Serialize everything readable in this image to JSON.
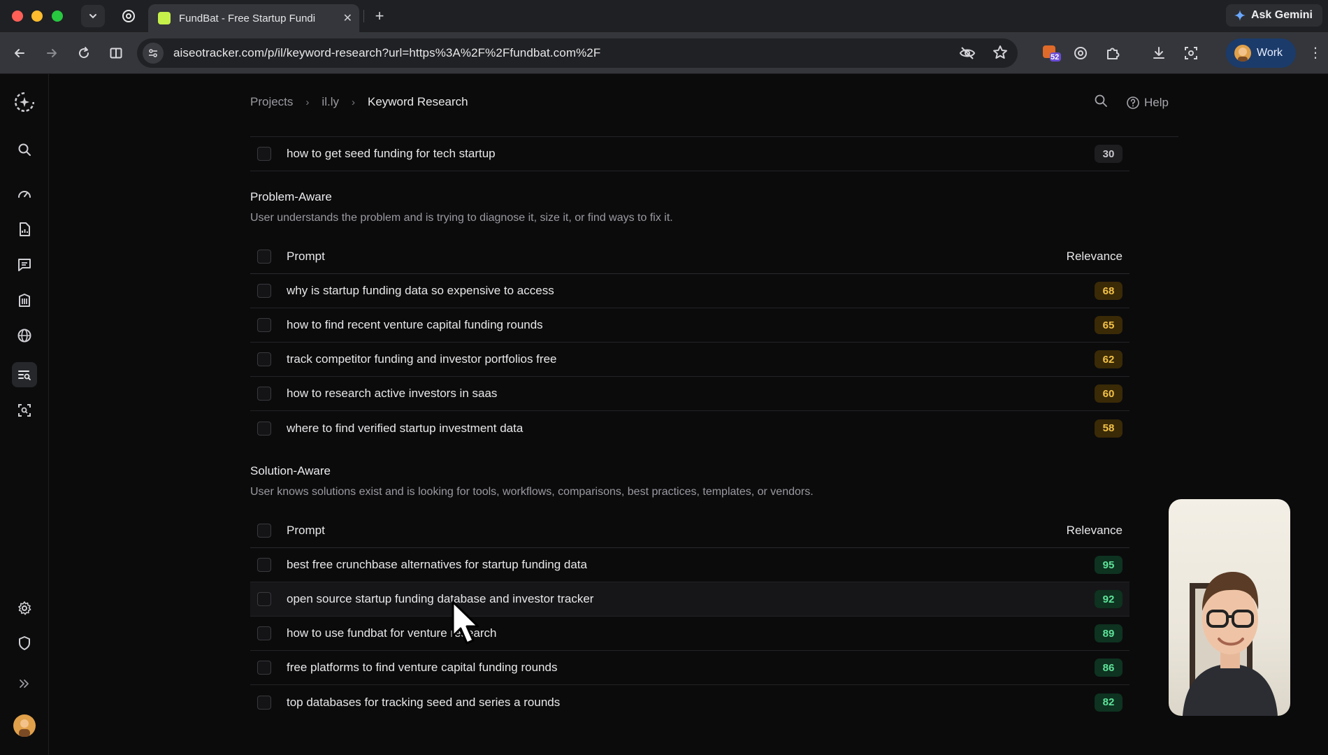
{
  "browser": {
    "tab_title": "FundBat - Free Startup Fundi",
    "url": "aiseotracker.com/p/il/keyword-research?url=https%3A%2F%2Ffundbat.com%2F",
    "ask_gemini": "Ask Gemini",
    "profile_label": "Work",
    "extension_badge": "52"
  },
  "breadcrumb": {
    "items": [
      "Projects",
      "il.ly",
      "Keyword Research"
    ]
  },
  "top_actions": {
    "help_label": "Help"
  },
  "top_row": {
    "prompt": "how to get seed funding for tech startup",
    "relevance": "30"
  },
  "sections": [
    {
      "title": "Problem-Aware",
      "description": "User understands the problem and is trying to diagnose it, size it, or find ways to fix it.",
      "header": {
        "prompt": "Prompt",
        "relevance": "Relevance"
      },
      "rows": [
        {
          "prompt": "why is startup funding data so expensive to access",
          "relevance": "68"
        },
        {
          "prompt": "how to find recent venture capital funding rounds",
          "relevance": "65"
        },
        {
          "prompt": "track competitor funding and investor portfolios free",
          "relevance": "62"
        },
        {
          "prompt": "how to research active investors in saas",
          "relevance": "60"
        },
        {
          "prompt": "where to find verified startup investment data",
          "relevance": "58"
        }
      ]
    },
    {
      "title": "Solution-Aware",
      "description": "User knows solutions exist and is looking for tools, workflows, comparisons, best practices, templates, or vendors.",
      "header": {
        "prompt": "Prompt",
        "relevance": "Relevance"
      },
      "rows": [
        {
          "prompt": "best free crunchbase alternatives for startup funding data",
          "relevance": "95"
        },
        {
          "prompt": "open source startup funding database and investor tracker",
          "relevance": "92"
        },
        {
          "prompt": "how to use fundbat for venture research",
          "relevance": "89"
        },
        {
          "prompt": "free platforms to find venture capital funding rounds",
          "relevance": "86"
        },
        {
          "prompt": "top databases for tracking seed and series a rounds",
          "relevance": "82"
        }
      ]
    }
  ],
  "colors": {
    "badge_amber": "#f3c247",
    "badge_green": "#5ee39a",
    "background": "#0b0b0c"
  }
}
